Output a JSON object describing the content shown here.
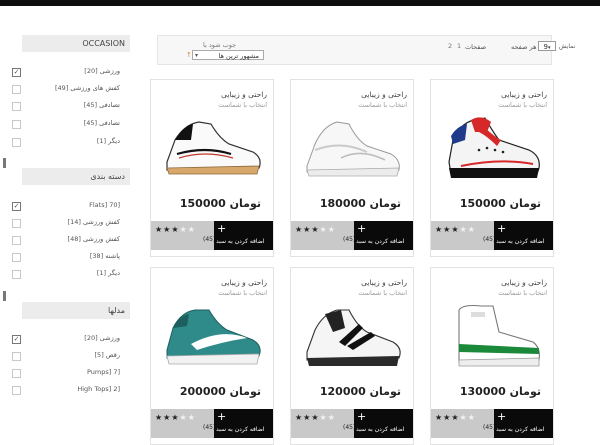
{
  "colors": {
    "topbar": "#0d0d0d",
    "cart_bg": "#0a0a0a",
    "rating_bg": "#c9c9c9",
    "accent": "#e08a2b"
  },
  "sidebar": {
    "sections": [
      {
        "title": "OCCASION",
        "items": [
          {
            "label": "ورزشی [20]",
            "checked": true
          },
          {
            "label": "کفش های ورزشی [49]",
            "checked": false
          },
          {
            "label": "تصادفی [45]",
            "checked": false
          },
          {
            "label": "تصادفی [45]",
            "checked": false
          },
          {
            "label": "دیگر [1]",
            "checked": false
          }
        ]
      },
      {
        "title": "دسته بندی",
        "items": [
          {
            "label": "Flats] 70]",
            "checked": true
          },
          {
            "label": "کفش ورزشی [14]",
            "checked": false
          },
          {
            "label": "کفش ورزشی [48]",
            "checked": false
          },
          {
            "label": "پاشنه [38]",
            "checked": false
          },
          {
            "label": "دیگر [1]",
            "checked": false
          }
        ]
      },
      {
        "title": "مدلها",
        "items": [
          {
            "label": "ورزشی [20]",
            "checked": true
          },
          {
            "label": "رقص [5]",
            "checked": false
          },
          {
            "label": "Pumps] 7]",
            "checked": false
          },
          {
            "label": "High Tops] 2]",
            "checked": false
          }
        ]
      }
    ]
  },
  "toolbar": {
    "sort_label": "جوب شود با",
    "sort_value": "مشهور ترین ها",
    "pages_label": "صفحات",
    "page_numbers": [
      "2",
      "1"
    ],
    "per_page_label": "هر صفحه",
    "per_page_value": "9",
    "show_label": "نمایش"
  },
  "products": [
    {
      "title": "راحتی و زیبایی",
      "subtitle": "انتخاب با شماست",
      "price": "150000 تومان",
      "rating": 3,
      "max_rating": 5,
      "reviews": "(45)",
      "cart": "اضافه کردن به سبد",
      "shoe": "red-high"
    },
    {
      "title": "راحتی و زیبایی",
      "subtitle": "انتخاب با شماست",
      "price": "180000 تومان",
      "rating": 3,
      "max_rating": 5,
      "reviews": "(45)",
      "cart": "اضافه کردن به سبد",
      "shoe": "white-running"
    },
    {
      "title": "راحتی و زیبایی",
      "subtitle": "انتخاب با شماست",
      "price": "150000 تومان",
      "rating": 3,
      "max_rating": 5,
      "reviews": "(45)",
      "cart": "اضافه کردن به سبد",
      "shoe": "black-white"
    },
    {
      "title": "راحتی و زیبایی",
      "subtitle": "انتخاب با شماست",
      "price": "130000 تومان",
      "rating": 3,
      "max_rating": 5,
      "reviews": "(45)",
      "cart": "اضافه کردن به سبد",
      "shoe": "white-green-high"
    },
    {
      "title": "راحتی و زیبایی",
      "subtitle": "انتخاب با شماست",
      "price": "120000 تومان",
      "rating": 3,
      "max_rating": 5,
      "reviews": "(45)",
      "cart": "اضافه کردن به سبد",
      "shoe": "black-stripe"
    },
    {
      "title": "راحتی و زیبایی",
      "subtitle": "انتخاب با شماست",
      "price": "200000 تومان",
      "rating": 3,
      "max_rating": 5,
      "reviews": "(45)",
      "cart": "اضافه کردن به سبد",
      "shoe": "teal-nike"
    }
  ]
}
